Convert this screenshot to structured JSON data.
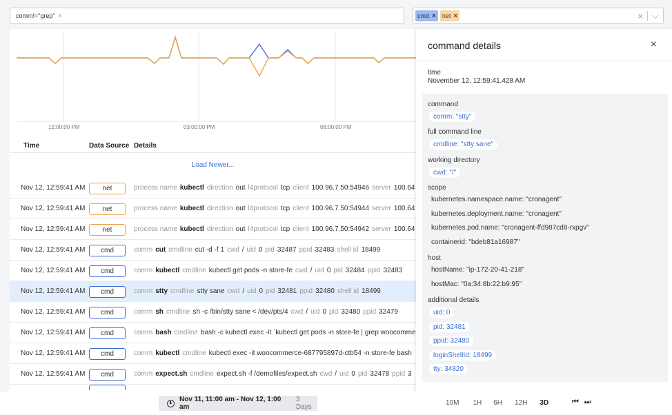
{
  "filter": {
    "query_chip": "comm!=\"grep\"",
    "query_chip_remove": "×"
  },
  "sources": {
    "tags": [
      {
        "label": "cmd",
        "remove": "×"
      },
      {
        "label": "net",
        "remove": "×"
      }
    ],
    "clear": "×",
    "dropdown": "⌵"
  },
  "chart": {
    "x_tick_labels": [
      "12:00:00 PM",
      "03:00:00 PM",
      "06:00:00 PM"
    ],
    "colors": {
      "cmd": "#4a7bd8",
      "net": "#f0a94e"
    }
  },
  "table": {
    "headers": {
      "time": "Time",
      "source": "Data Source",
      "details": "Details"
    },
    "load_newer": "Load Newer...",
    "rows": [
      {
        "time": "Nov 12, 12:59:41 AM",
        "source": "net",
        "details": [
          {
            "k": "process name",
            "v": "kubectl",
            "b": true
          },
          {
            "k": "direction",
            "v": "out"
          },
          {
            "k": "l4protocol",
            "v": "tcp"
          },
          {
            "k": "client",
            "v": "100.96.7.50:54946"
          },
          {
            "k": "server",
            "v": "100.64"
          }
        ]
      },
      {
        "time": "Nov 12, 12:59:41 AM",
        "source": "net",
        "details": [
          {
            "k": "process name",
            "v": "kubectl",
            "b": true
          },
          {
            "k": "direction",
            "v": "out"
          },
          {
            "k": "l4protocol",
            "v": "tcp"
          },
          {
            "k": "client",
            "v": "100.96.7.50:54944"
          },
          {
            "k": "server",
            "v": "100.64"
          }
        ]
      },
      {
        "time": "Nov 12, 12:59:41 AM",
        "source": "net",
        "details": [
          {
            "k": "process name",
            "v": "kubectl",
            "b": true
          },
          {
            "k": "direction",
            "v": "out"
          },
          {
            "k": "l4protocol",
            "v": "tcp"
          },
          {
            "k": "client",
            "v": "100.96.7.50:54942"
          },
          {
            "k": "server",
            "v": "100.64"
          }
        ]
      },
      {
        "time": "Nov 12, 12:59:41 AM",
        "source": "cmd",
        "details": [
          {
            "k": "comm",
            "v": "cut",
            "b": true
          },
          {
            "k": "cmdline",
            "v": "cut -d -f 1"
          },
          {
            "k": "cwd",
            "v": "/"
          },
          {
            "k": "uid",
            "v": "0"
          },
          {
            "k": "pid",
            "v": "32487"
          },
          {
            "k": "ppid",
            "v": "32483"
          },
          {
            "k": "shell id",
            "v": "18499"
          }
        ]
      },
      {
        "time": "Nov 12, 12:59:41 AM",
        "source": "cmd",
        "details": [
          {
            "k": "comm",
            "v": "kubectl",
            "b": true
          },
          {
            "k": "cmdline",
            "v": "kubectl get pods -n store-fe"
          },
          {
            "k": "cwd",
            "v": "/"
          },
          {
            "k": "uid",
            "v": "0"
          },
          {
            "k": "pid",
            "v": "32484"
          },
          {
            "k": "ppid",
            "v": "32483"
          }
        ]
      },
      {
        "time": "Nov 12, 12:59:41 AM",
        "source": "cmd",
        "selected": true,
        "details": [
          {
            "k": "comm",
            "v": "stty",
            "b": true
          },
          {
            "k": "cmdline",
            "v": "stty sane"
          },
          {
            "k": "cwd",
            "v": "/"
          },
          {
            "k": "uid",
            "v": "0"
          },
          {
            "k": "pid",
            "v": "32481"
          },
          {
            "k": "ppid",
            "v": "32480"
          },
          {
            "k": "shell id",
            "v": "18499"
          }
        ]
      },
      {
        "time": "Nov 12, 12:59:41 AM",
        "source": "cmd",
        "details": [
          {
            "k": "comm",
            "v": "sh",
            "b": true
          },
          {
            "k": "cmdline",
            "v": "sh -c /bin/stty sane < /dev/pts/4"
          },
          {
            "k": "cwd",
            "v": "/"
          },
          {
            "k": "uid",
            "v": "0"
          },
          {
            "k": "pid",
            "v": "32480"
          },
          {
            "k": "ppid",
            "v": "32479"
          }
        ]
      },
      {
        "time": "Nov 12, 12:59:41 AM",
        "source": "cmd",
        "details": [
          {
            "k": "comm",
            "v": "bash",
            "b": true
          },
          {
            "k": "cmdline",
            "v": "bash -c kubectl exec -it `kubectl get pods -n store-fe | grep woocommerce"
          }
        ]
      },
      {
        "time": "Nov 12, 12:59:41 AM",
        "source": "cmd",
        "details": [
          {
            "k": "comm",
            "v": "kubectl",
            "b": true
          },
          {
            "k": "cmdline",
            "v": "kubectl exec -it woocommerce-687795897d-ctb54 -n store-fe bash"
          }
        ]
      },
      {
        "time": "Nov 12, 12:59:41 AM",
        "source": "cmd",
        "details": [
          {
            "k": "comm",
            "v": "expect.sh",
            "b": true
          },
          {
            "k": "cmdline",
            "v": "expect.sh -f /demofiles/expect.sh"
          },
          {
            "k": "cwd",
            "v": "/"
          },
          {
            "k": "uid",
            "v": "0"
          },
          {
            "k": "pid",
            "v": "32478"
          },
          {
            "k": "ppid",
            "v": "3"
          }
        ]
      }
    ]
  },
  "details_panel": {
    "title": "command details",
    "close": "×",
    "time_label": "time",
    "time_value": "November 12, 12:59:41.428 AM",
    "sections": {
      "command": "command",
      "command_pill": "comm: \"stty\"",
      "full_command_line": "full command line",
      "cmdline_pill": "cmdline: \"stty sane\"",
      "working_directory": "working directory",
      "cwd_pill": "cwd: \"/\"",
      "scope": "scope",
      "scope_values": [
        "kubernetes.namespace.name: \"cronagent\"",
        "kubernetes.deployment.name: \"cronagent\"",
        "kubernetes.pod.name: \"cronagent-ffd987cd8-rxpgv\"",
        "containerid: \"bdeb81a16987\""
      ],
      "host": "host",
      "host_values": [
        "hostName: \"ip-172-20-41-218\"",
        "hostMac: \"0a:34:8b:22:b9:95\""
      ],
      "additional": "additional details",
      "additional_pills": [
        "uid: 0",
        "pid: 32481",
        "ppid: 32480",
        "loginShellId: 18499",
        "tty: 34820"
      ]
    }
  },
  "bottom": {
    "range": "Nov 11, 11:00 am - Nov 12, 1:00 am",
    "range_days": "3 Days",
    "zooms": [
      "10M",
      "1H",
      "6H",
      "12H",
      "3D"
    ],
    "active_zoom": "3D",
    "first": "⏮",
    "next": "⏭"
  }
}
